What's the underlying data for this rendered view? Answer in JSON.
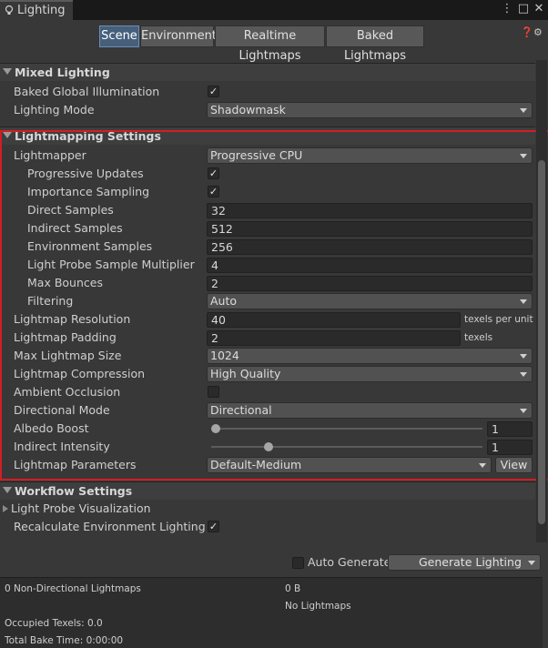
{
  "window": {
    "tab_title": "Lighting"
  },
  "scene_tabs": [
    "Scene",
    "Environment",
    "Realtime Lightmaps",
    "Baked Lightmaps"
  ],
  "sections": {
    "mixed": "Mixed Lighting",
    "lightmapping": "Lightmapping Settings",
    "workflow": "Workflow Settings"
  },
  "mixed": {
    "bgi_label": "Baked Global Illumination",
    "lighting_mode_label": "Lighting Mode",
    "lighting_mode_value": "Shadowmask"
  },
  "lightmapping": {
    "lightmapper_label": "Lightmapper",
    "lightmapper_value": "Progressive CPU",
    "progressive_updates_label": "Progressive Updates",
    "importance_sampling_label": "Importance Sampling",
    "direct_samples_label": "Direct Samples",
    "direct_samples_value": "32",
    "indirect_samples_label": "Indirect Samples",
    "indirect_samples_value": "512",
    "environment_samples_label": "Environment Samples",
    "environment_samples_value": "256",
    "probe_multiplier_label": "Light Probe Sample Multiplier",
    "probe_multiplier_value": "4",
    "max_bounces_label": "Max Bounces",
    "max_bounces_value": "2",
    "filtering_label": "Filtering",
    "filtering_value": "Auto",
    "resolution_label": "Lightmap Resolution",
    "resolution_value": "40",
    "resolution_unit": "texels per unit",
    "padding_label": "Lightmap Padding",
    "padding_value": "2",
    "padding_unit": "texels",
    "max_size_label": "Max Lightmap Size",
    "max_size_value": "1024",
    "compression_label": "Lightmap Compression",
    "compression_value": "High Quality",
    "ao_label": "Ambient Occlusion",
    "directional_label": "Directional Mode",
    "directional_value": "Directional",
    "albedo_label": "Albedo Boost",
    "albedo_value": "1",
    "albedo_level": 0.0,
    "indirect_intensity_label": "Indirect Intensity",
    "indirect_intensity_value": "1",
    "indirect_intensity_level": 0.2,
    "params_label": "Lightmap Parameters",
    "params_value": "Default-Medium",
    "view_label": "View"
  },
  "workflow": {
    "probe_vis_label": "Light Probe Visualization",
    "recalc_label": "Recalculate Environment Lighting"
  },
  "footer": {
    "auto_generate_label": "Auto Generate",
    "generate_label": "Generate Lighting"
  },
  "stats": {
    "non_directional": "0 Non-Directional Lightmaps",
    "size": "0 B",
    "no_lightmaps": "No Lightmaps",
    "occupied": "Occupied Texels: 0.0",
    "bake_time": "Total Bake Time: 0:00:00"
  },
  "colors": {
    "accent": "#46607c",
    "highlight": "#d01e24"
  },
  "icons": [
    "lighting-icon",
    "more-icon",
    "maximize-icon",
    "close-icon",
    "help-icon",
    "gear-icon",
    "checkmark-icon",
    "dropdown-arrow-icon"
  ]
}
